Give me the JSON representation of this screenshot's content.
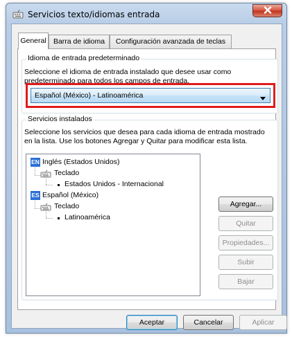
{
  "window": {
    "title": "Servicios texto/idiomas entrada",
    "close_label": "x"
  },
  "tabs": [
    {
      "label": "General",
      "active": true
    },
    {
      "label": "Barra de idioma",
      "active": false
    },
    {
      "label": "Configuración avanzada de teclas",
      "active": false
    }
  ],
  "default_input": {
    "group_title": "Idioma de entrada predeterminado",
    "description_line1": "Seleccione el idioma de entrada instalado que desee usar como",
    "description_line2": "predeterminado para todos los campos de entrada.",
    "selected": "Español (México) - Latinoamérica",
    "highlight_color": "#e01b1b"
  },
  "installed_services": {
    "group_title": "Servicios instalados",
    "description_line1": "Seleccione los servicios que desea para cada idioma de entrada mostrado",
    "description_line2": "en la lista. Use los botones Agregar y Quitar para modificar esta lista.",
    "tree": [
      {
        "badge": "EN",
        "language": "Inglés (Estados Unidos)",
        "category": "Teclado",
        "layout": "Estados Unidos - Internacional"
      },
      {
        "badge": "ES",
        "language": "Español (México)",
        "category": "Teclado",
        "layout": "Latinoamérica"
      }
    ],
    "buttons": {
      "add": "Agregar...",
      "remove": "Quitar",
      "properties": "Propiedades...",
      "move_up": "Subir",
      "move_down": "Bajar"
    }
  },
  "footer": {
    "ok": "Aceptar",
    "cancel": "Cancelar",
    "apply": "Aplicar"
  },
  "colors": {
    "accent": "#2a6fd6",
    "highlight": "#e01b1b",
    "close_button": "#c2321c"
  }
}
